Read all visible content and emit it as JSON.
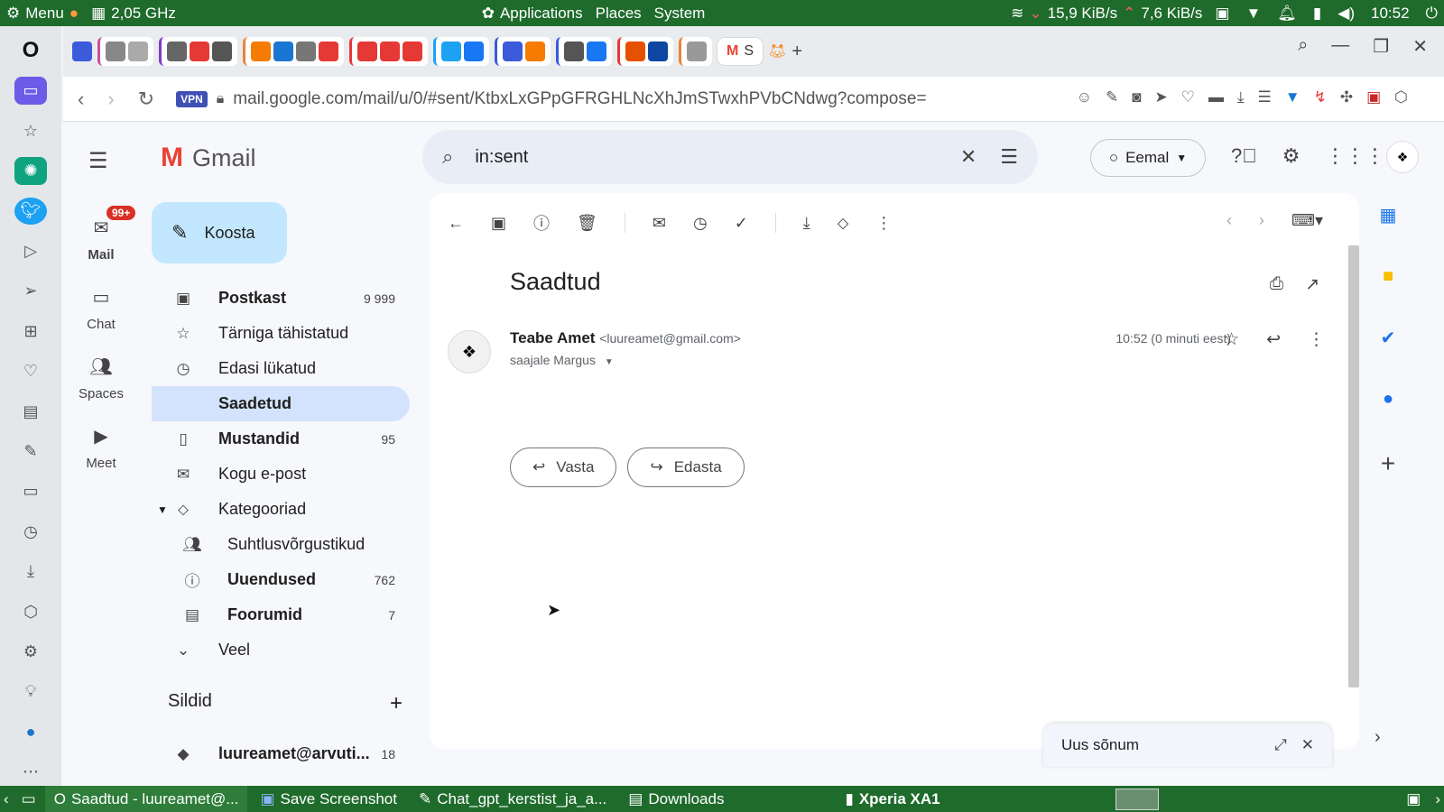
{
  "system_top": {
    "menu_label": "Menu",
    "cpu_freq": "2,05 GHz",
    "applications": "Applications",
    "places": "Places",
    "system": "System",
    "net_down": "15,9 KiB/s",
    "net_up": "7,6 KiB/s",
    "clock": "10:52"
  },
  "browser": {
    "active_tab_label": "S",
    "vpn_label": "VPN",
    "url": "mail.google.com/mail/u/0/#sent/KtbxLxGPpGFRGHLNcXhJmSTwxhPVbCNdwg?compose="
  },
  "gmail": {
    "logo_text": "Gmail",
    "rail": [
      {
        "label": "Mail",
        "badge": "99+"
      },
      {
        "label": "Chat"
      },
      {
        "label": "Spaces"
      },
      {
        "label": "Meet"
      }
    ],
    "compose_label": "Koosta",
    "folders": [
      {
        "label": "Postkast",
        "count": "9 999",
        "icon": "inbox-icon"
      },
      {
        "label": "Tärniga tähistatud",
        "count": "",
        "icon": "star-icon"
      },
      {
        "label": "Edasi lükatud",
        "count": "",
        "icon": "clock-icon"
      },
      {
        "label": "Saadetud",
        "count": "",
        "icon": "send-icon"
      },
      {
        "label": "Mustandid",
        "count": "95",
        "icon": "draft-icon"
      },
      {
        "label": "Kogu e-post",
        "count": "",
        "icon": "all-mail-icon"
      },
      {
        "label": "Kategooriad",
        "count": "",
        "icon": "label-icon"
      },
      {
        "label": "Suhtlusvõrgustikud",
        "count": "",
        "icon": "people-icon"
      },
      {
        "label": "Uuendused",
        "count": "762",
        "icon": "info-icon"
      },
      {
        "label": "Foorumid",
        "count": "7",
        "icon": "forum-icon"
      },
      {
        "label": "Veel",
        "count": "",
        "icon": "chevron-down-icon"
      }
    ],
    "labels_heading": "Sildid",
    "label_items": [
      {
        "label": "luureamet@arvuti...",
        "count": "18"
      }
    ],
    "search_query": "in:sent",
    "status_label": "Eemal",
    "message": {
      "subject": "Saadtud",
      "sender_name": "Teabe Amet",
      "sender_email": "<luureamet@gmail.com>",
      "recipient": "saajale Margus",
      "time": "10:52 (0 minuti eest)",
      "reply_label": "Vasta",
      "forward_label": "Edasta"
    },
    "new_message_title": "Uus sõnum"
  },
  "taskbar": {
    "items": [
      "Saadtud - luureamet@...",
      "Save Screenshot",
      "Chat_gpt_kerstist_ja_a...",
      "Downloads",
      "Xperia XA1"
    ]
  }
}
